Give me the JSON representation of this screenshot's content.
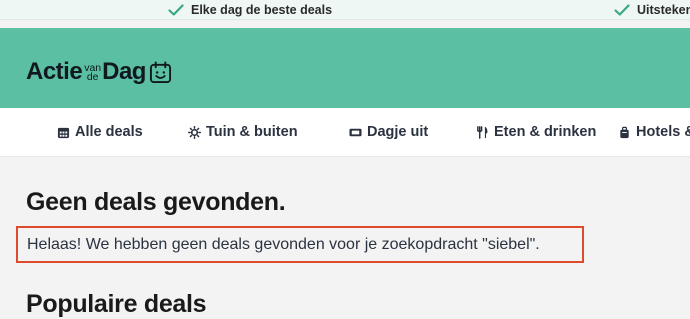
{
  "usp_bar": {
    "items": [
      {
        "text": "Elke dag de beste deals",
        "icon": "checkmark-icon"
      },
      {
        "text": "Uitsteken",
        "icon": "checkmark-icon"
      }
    ],
    "check_color": "#3aa887"
  },
  "header": {
    "background": "#5bbfa3",
    "logo": {
      "word1": "Actie",
      "small_top": "van",
      "small_bottom": "de",
      "word2": "Dag",
      "icon": "smiling-calendar-icon"
    }
  },
  "nav": {
    "items": [
      {
        "label": "Alle deals",
        "icon": "calendar-grid-icon"
      },
      {
        "label": "Tuin & buiten",
        "icon": "sun-icon"
      },
      {
        "label": "Dagje uit",
        "icon": "ticket-icon"
      },
      {
        "label": "Eten & drinken",
        "icon": "fork-knife-icon"
      },
      {
        "label": "Hotels &",
        "icon": "suitcase-icon"
      }
    ]
  },
  "main": {
    "title": "Geen deals gevonden.",
    "message": "Helaas! We hebben geen deals gevonden voor je zoekopdracht \"siebel\".",
    "highlight_color": "#dd4a2e",
    "popular_title": "Populaire deals"
  }
}
